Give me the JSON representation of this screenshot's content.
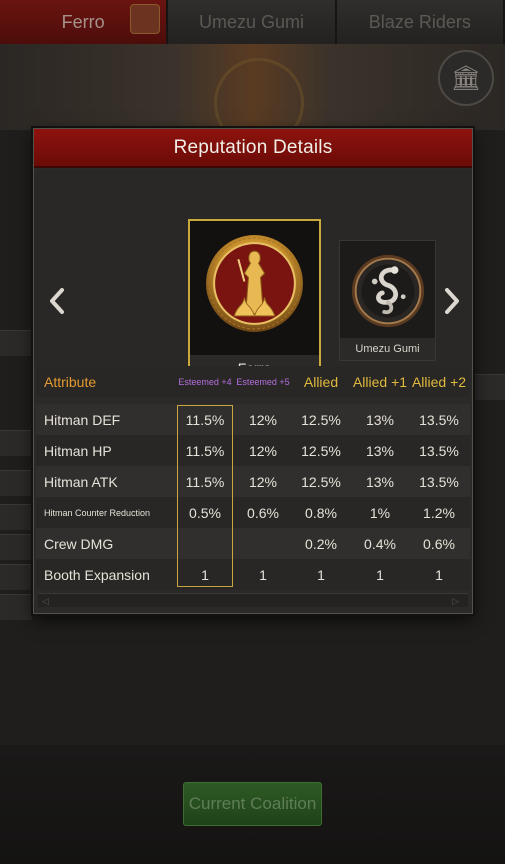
{
  "background": {
    "tabs": [
      "Ferro",
      "Umezu Gumi",
      "Blaze Riders"
    ],
    "coalition_button": "Current Coalition"
  },
  "modal": {
    "title": "Reputation Details",
    "factions": [
      {
        "name": "Ferro",
        "emblem": "ferro-lady-emblem",
        "selected": true
      },
      {
        "name": "Umezu Gumi",
        "emblem": "umezu-snake-emblem",
        "selected": false
      }
    ],
    "nav": {
      "left_icon": "chevron-left-icon",
      "right_icon": "chevron-right-icon"
    },
    "table": {
      "header_label": "Attribute",
      "columns": [
        "Esteemed +4",
        "Esteemed +5",
        "Allied",
        "Allied +1",
        "Allied +2"
      ],
      "rows": [
        {
          "label": "Hitman DEF",
          "values": [
            "11.5%",
            "12%",
            "12.5%",
            "13%",
            "13.5%"
          ]
        },
        {
          "label": "Hitman HP",
          "values": [
            "11.5%",
            "12%",
            "12.5%",
            "13%",
            "13.5%"
          ]
        },
        {
          "label": "Hitman ATK",
          "values": [
            "11.5%",
            "12%",
            "12.5%",
            "13%",
            "13.5%"
          ]
        },
        {
          "label": "Hitman Counter Reduction",
          "values": [
            "0.5%",
            "0.6%",
            "0.8%",
            "1%",
            "1.2%"
          ]
        },
        {
          "label": "Crew DMG",
          "values": [
            "",
            "",
            "0.2%",
            "0.4%",
            "0.6%"
          ]
        },
        {
          "label": "Booth Expansion",
          "values": [
            "1",
            "1",
            "1",
            "1",
            "1"
          ]
        }
      ],
      "highlighted_column": "Esteemed +4"
    }
  },
  "colors": {
    "header_red": "#8e130e",
    "gold_border": "#c8a93c",
    "attribute_orange": "#e49a30",
    "allied_gold": "#e0b93d",
    "esteemed_purple": "#b56fe0"
  }
}
